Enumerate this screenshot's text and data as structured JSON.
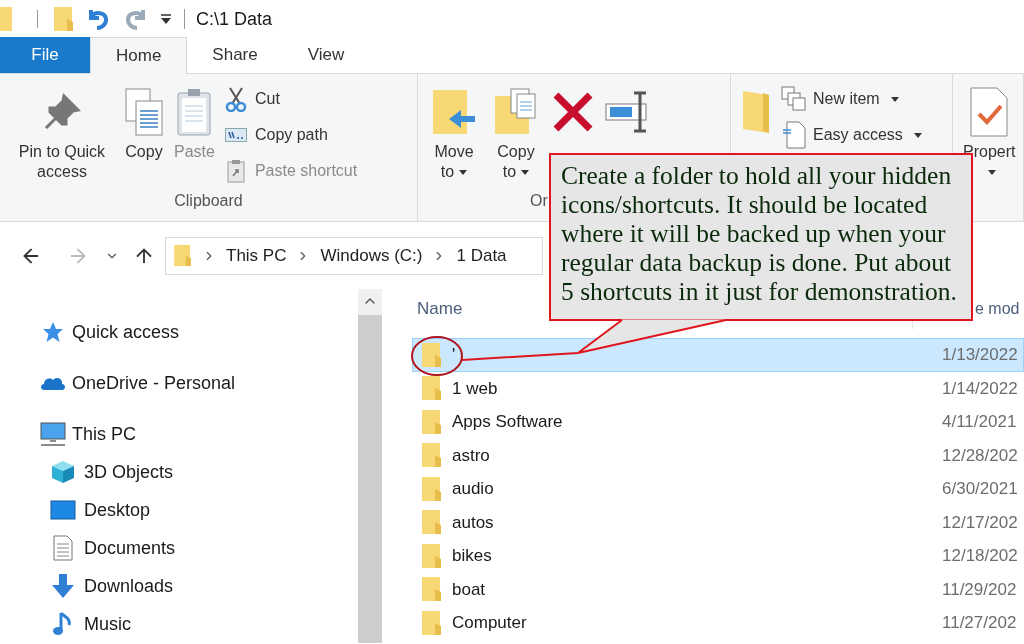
{
  "title_bar": {
    "path": "C:\\1 Data",
    "undo_enabled": true,
    "redo_enabled": false
  },
  "ribbon_tabs": [
    {
      "label": "File",
      "kind": "file",
      "selected": false
    },
    {
      "label": "Home",
      "kind": "tab",
      "selected": true
    },
    {
      "label": "Share",
      "kind": "tab",
      "selected": false
    },
    {
      "label": "View",
      "kind": "tab",
      "selected": false
    }
  ],
  "ribbon_groups": [
    {
      "label": "Clipboard",
      "buttons": [
        {
          "kind": "large",
          "label": "Pin to Quick access",
          "disabled": false,
          "has_menu": false
        },
        {
          "kind": "large",
          "label": "Copy",
          "disabled": false,
          "has_menu": false
        },
        {
          "kind": "large",
          "label": "Paste",
          "disabled": true,
          "has_menu": false
        },
        {
          "kind": "small",
          "label": "Cut",
          "disabled": false,
          "has_menu": false
        },
        {
          "kind": "small",
          "label": "Copy path",
          "disabled": false,
          "has_menu": false
        },
        {
          "kind": "small",
          "label": "Paste shortcut",
          "disabled": true,
          "has_menu": false
        }
      ]
    },
    {
      "label": "Or",
      "buttons": [
        {
          "kind": "large",
          "label": "Move to",
          "disabled": false,
          "has_menu": true
        },
        {
          "kind": "large",
          "label": "Copy to",
          "disabled": false,
          "has_menu": true
        },
        {
          "kind": "icon_only"
        },
        {
          "kind": "icon_only"
        }
      ]
    },
    {
      "buttons": [
        {
          "kind": "icon_only"
        },
        {
          "kind": "small",
          "label": "New item",
          "disabled": false,
          "has_menu": true
        },
        {
          "kind": "small",
          "label": "Easy access",
          "disabled": false,
          "has_menu": true
        }
      ]
    },
    {
      "buttons": [
        {
          "kind": "large",
          "label": "Propert",
          "disabled": false,
          "has_menu": true
        }
      ]
    }
  ],
  "navigation": {
    "back_enabled": true,
    "forward_enabled": false
  },
  "address": {
    "segments": [
      "This PC",
      "Windows (C:)",
      "1 Data"
    ]
  },
  "sidebar": {
    "items": [
      {
        "label": "Quick access"
      },
      {
        "label": "OneDrive - Personal"
      },
      {
        "label": "This PC",
        "children": [
          {
            "label": "3D Objects"
          },
          {
            "label": "Desktop"
          },
          {
            "label": "Documents"
          },
          {
            "label": "Downloads"
          },
          {
            "label": "Music"
          }
        ]
      }
    ]
  },
  "file_list": {
    "columns": [
      "Name",
      "e mod"
    ],
    "rows": [
      {
        "name": "'",
        "date": "1/13/2022",
        "selected": true
      },
      {
        "name": "1 web",
        "date": "1/14/2022",
        "selected": false
      },
      {
        "name": "Apps Software",
        "date": "4/11/2021",
        "selected": false
      },
      {
        "name": "astro",
        "date": "12/28/202",
        "selected": false
      },
      {
        "name": "audio",
        "date": "6/30/2021",
        "selected": false
      },
      {
        "name": "autos",
        "date": "12/17/202",
        "selected": false
      },
      {
        "name": "bikes",
        "date": "12/18/202",
        "selected": false
      },
      {
        "name": "boat",
        "date": "11/29/202",
        "selected": false
      },
      {
        "name": "Computer",
        "date": "11/27/202",
        "selected": false
      }
    ]
  },
  "callout": {
    "text": "Create a folder to hold all your hidden icons/shortcuts. It should be located where it will be backed up when your regular data backup is done. Put about 5 shortcuts in it just for demonstration."
  }
}
